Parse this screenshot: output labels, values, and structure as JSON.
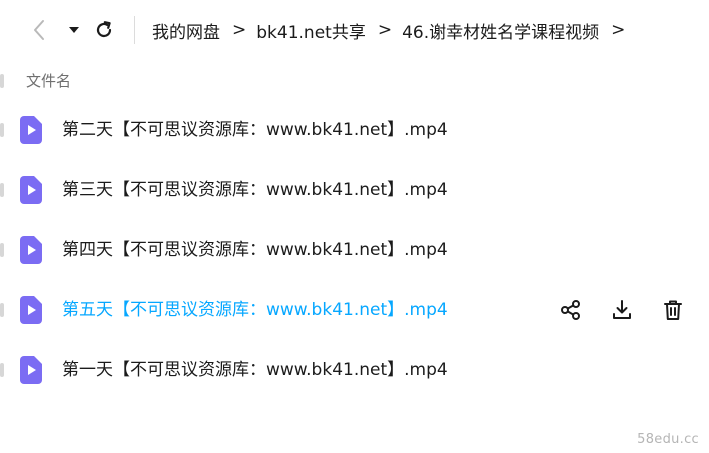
{
  "nav": {
    "back_icon": "chevron-left-icon",
    "dropdown_icon": "caret-down-icon",
    "refresh_icon": "refresh-icon"
  },
  "breadcrumb": {
    "items": [
      "我的网盘",
      "bk41.net共享",
      "46.谢幸材姓名学课程视频"
    ],
    "separator": ">"
  },
  "list": {
    "header": "文件名",
    "files": [
      {
        "name": "第二天【不可思议资源库：www.bk41.net】.mp4"
      },
      {
        "name": "第三天【不可思议资源库：www.bk41.net】.mp4"
      },
      {
        "name": "第四天【不可思议资源库：www.bk41.net】.mp4"
      },
      {
        "name": "第五天【不可思议资源库：www.bk41.net】.mp4"
      },
      {
        "name": "第一天【不可思议资源库：www.bk41.net】.mp4"
      }
    ],
    "hovered_index": 3,
    "file_icon": "video-file-icon"
  },
  "row_actions": {
    "icons": [
      "share-icon",
      "download-icon",
      "delete-icon"
    ]
  },
  "colors": {
    "accent": "#06a7ff",
    "video_icon": "#7b6cf3",
    "text": "#1b1b1b",
    "muted": "#6f6f6f"
  },
  "watermark": "58edu.cc"
}
